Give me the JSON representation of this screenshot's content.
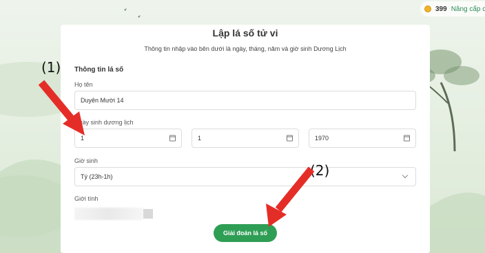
{
  "header": {
    "coin_count": "399",
    "upgrade_label": "Nâng cấp c"
  },
  "form": {
    "title": "Lập lá số tử vi",
    "subtitle": "Thông tin nhập vào bên dưới là ngày, tháng, năm và giờ sinh Dương Lịch",
    "section_title": "Thông tin lá số",
    "name_label": "Họ tên",
    "name_value": "Duyên Mười 14",
    "dob_label": "Ngày sinh dương lịch",
    "day_value": "1",
    "month_value": "1",
    "year_value": "1970",
    "birth_hour_label": "Giờ sinh",
    "birth_hour_value": "Tý (23h-1h)",
    "gender_label": "Giới tính",
    "submit_label": "Giải đoán lá số"
  },
  "annotations": {
    "step1": "(1)",
    "step2": "(2)"
  },
  "colors": {
    "accent_green": "#2f9e55",
    "arrow_red": "#e52d27"
  }
}
